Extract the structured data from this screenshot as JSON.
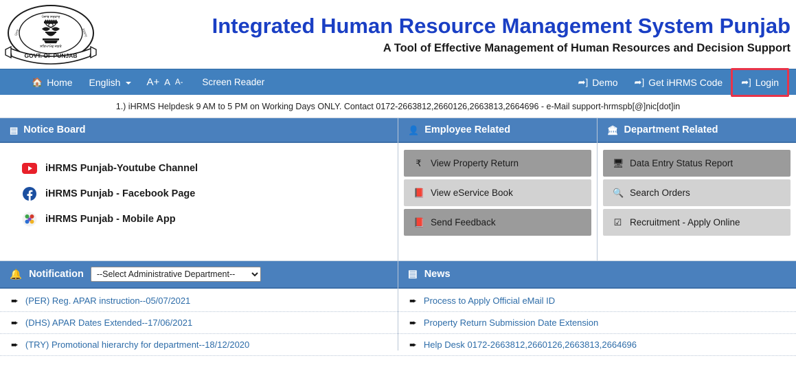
{
  "header": {
    "emblem_alt": "government-of-punjab-emblem",
    "title": "Integrated Human Resource Management System Punjab",
    "subtitle": "A Tool of Effective Management of Human Resources and Decision Support"
  },
  "nav": {
    "home": {
      "label": "Home",
      "icon": "home-icon"
    },
    "language": {
      "label": "English",
      "icon": "chevron-down-icon"
    },
    "font_size": {
      "increase": "A+",
      "normal": "A",
      "decrease": "A-"
    },
    "screen_reader": "Screen Reader",
    "demo": {
      "label": "Demo",
      "icon": "sign-in-icon"
    },
    "get_code": {
      "label": "Get iHRMS Code",
      "icon": "sign-in-icon"
    },
    "login": {
      "label": "Login",
      "icon": "sign-in-icon",
      "highlight_color": "#e8344a"
    }
  },
  "helpdesk": {
    "text": "1.) iHRMS Helpdesk 9 AM to 5 PM on Working Days ONLY. Contact 0172-2663812,2660126,2663813,2664696 - e-Mail support-hrmspb[@]nic[dot]in"
  },
  "notice_board": {
    "title": "Notice Board",
    "icon": "notice-board-icon",
    "items": [
      {
        "label": "iHRMS Punjab-Youtube Channel",
        "icon": "youtube-icon"
      },
      {
        "label": "iHRMS Punjab - Facebook Page",
        "icon": "facebook-icon"
      },
      {
        "label": "iHRMS Punjab - Mobile App",
        "icon": "mobile-app-icon"
      }
    ]
  },
  "employee_related": {
    "title": "Employee Related",
    "icon": "user-icon",
    "items": [
      {
        "label": "View Property Return",
        "icon": "rupee-icon",
        "style": "dark"
      },
      {
        "label": "View eService Book",
        "icon": "book-icon",
        "style": "light"
      },
      {
        "label": "Send Feedback",
        "icon": "book-icon",
        "style": "dark"
      }
    ]
  },
  "department_related": {
    "title": "Department Related",
    "icon": "bank-icon",
    "items": [
      {
        "label": "Data Entry Status Report",
        "icon": "monitor-icon",
        "style": "dark"
      },
      {
        "label": "Search Orders",
        "icon": "search-icon",
        "style": "light"
      },
      {
        "label": "Recruitment - Apply Online",
        "icon": "check-square-icon",
        "style": "light"
      }
    ]
  },
  "notification": {
    "title": "Notification",
    "icon": "bell-icon",
    "department_select": {
      "selected": "--Select Administrative Department--",
      "options": [
        "--Select Administrative Department--"
      ]
    },
    "items": [
      {
        "label": "(PER) Reg. APAR instruction--05/07/2021",
        "icon": "arrow-circle-right-icon"
      },
      {
        "label": "(DHS) APAR Dates Extended--17/06/2021",
        "icon": "arrow-circle-right-icon"
      },
      {
        "label": "(TRY) Promotional hierarchy for department--18/12/2020",
        "icon": "arrow-circle-right-icon"
      }
    ]
  },
  "news": {
    "title": "News",
    "icon": "news-icon",
    "items": [
      {
        "label": "Process to Apply Official eMail ID",
        "icon": "arrow-circle-right-icon"
      },
      {
        "label": "Property Return Submission Date Extension",
        "icon": "arrow-circle-right-icon"
      },
      {
        "label": "Help Desk 0172-2663812,2660126,2663813,2664696",
        "icon": "arrow-circle-right-icon"
      }
    ]
  },
  "colors": {
    "nav_blue": "#4180be",
    "panel_blue": "#4a80bd",
    "title_blue": "#1a3fc4",
    "link_blue": "#2d6ca8",
    "btn_dark": "#9b9b9b",
    "btn_light": "#d2d2d2",
    "highlight_red": "#e8344a"
  }
}
